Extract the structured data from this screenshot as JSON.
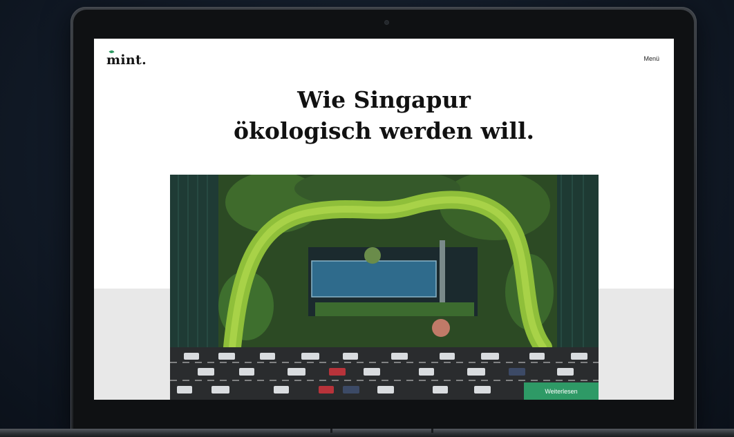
{
  "site": {
    "logo": "mint.",
    "menu_label": "Menü",
    "headline_line1": "Wie Singapur",
    "headline_line2": "ökologisch werden will.",
    "cta_label": "Weiterlesen",
    "hero_image": "aerial view of green terraced building with pool above street traffic"
  },
  "colors": {
    "accent": "#2e9a66",
    "page_bg": "#ffffff",
    "band_gray": "#e8e8e8",
    "frame_bg": "#121b28"
  }
}
